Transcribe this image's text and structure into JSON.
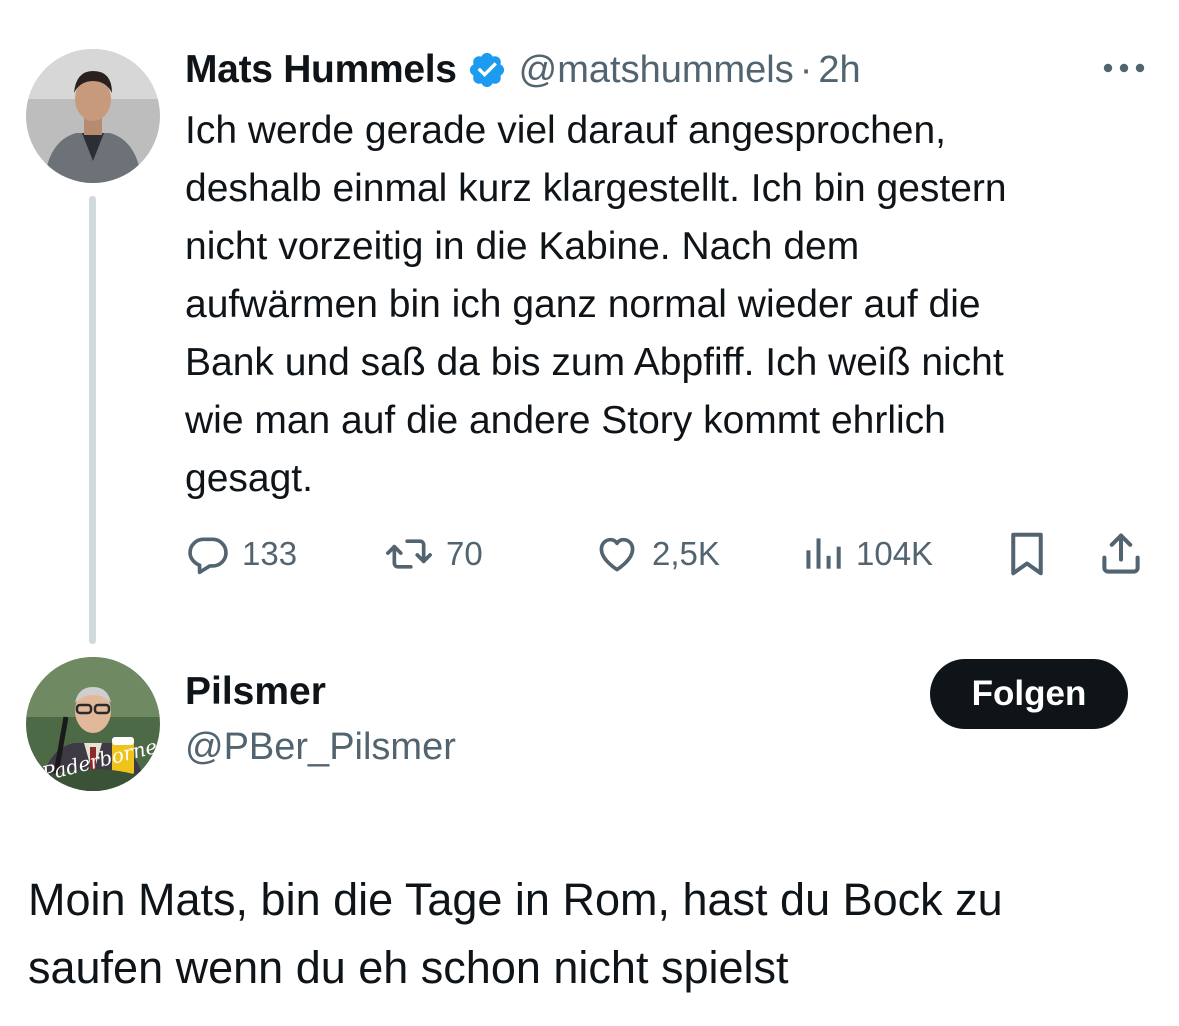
{
  "tweet": {
    "author_name": "Mats Hummels",
    "verified_icon": "verified-badge-icon",
    "handle": "@matshummels",
    "separator": "·",
    "time": "2h",
    "text": "Ich werde gerade viel darauf angesprochen,\ndeshalb einmal kurz klargestellt. Ich bin gestern\nnicht vorzeitig in die Kabine. Nach dem\naufwärmen bin ich ganz normal wieder auf die\nBank und saß da bis zum Abpfiff. Ich weiß nicht\nwie man auf die andere Story kommt ehrlich\ngesagt.",
    "actions": {
      "replies": "133",
      "reposts": "70",
      "likes": "2,5K",
      "views": "104K"
    }
  },
  "reply": {
    "author_name": "Pilsmer",
    "handle": "@PBer_Pilsmer",
    "avatar_text": "Paderborner",
    "follow_label": "Folgen",
    "text": "Moin Mats, bin die Tage in Rom, hast du Bock zu\nsaufen wenn du eh schon nicht spielst"
  },
  "colors": {
    "text": "#0f1419",
    "secondary": "#536471",
    "verified": "#1d9bf0",
    "thread_line": "#cfd9de",
    "follow_bg": "#0f1419"
  }
}
